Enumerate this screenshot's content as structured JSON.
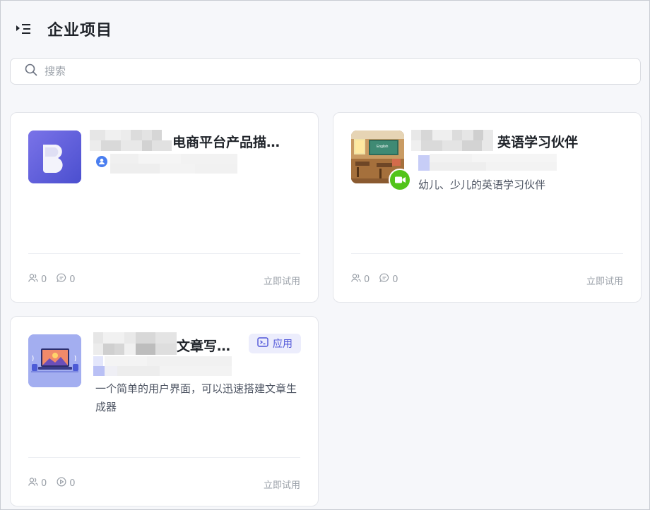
{
  "header": {
    "title": "企业项目"
  },
  "search": {
    "placeholder": "搜索",
    "value": ""
  },
  "cards": [
    {
      "title": "电商平台产品描…",
      "description": "",
      "users": "0",
      "messages": "0",
      "action": "立即试用"
    },
    {
      "title": "英语学习伙伴",
      "description": "幼儿、少儿的英语学习伙伴",
      "users": "0",
      "messages": "0",
      "action": "立即试用"
    },
    {
      "title": "文章写…",
      "badge": "应用",
      "description": "一个简单的用户界面，可以迅速搭建文章生成器",
      "users": "0",
      "runs": "0",
      "action": "立即试用"
    }
  ],
  "colors": {
    "accent": "#5b5fe0",
    "video_badge": "#52c41a",
    "badge_bg": "#ecedfc"
  }
}
